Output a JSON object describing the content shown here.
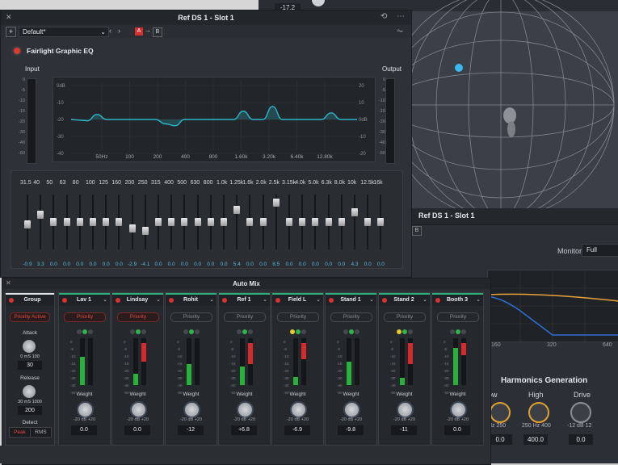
{
  "background": {
    "top_readout": "-17.2"
  },
  "ref_panel": {
    "title": "Ref DS 1 - Slot 1",
    "b_button": "B",
    "monitor_label": "Monitor",
    "monitor_value": "Full",
    "graph_ticks": [
      "160",
      "320",
      "640"
    ],
    "harmonics_title": "Harmonics Generation",
    "knobs": [
      {
        "label": "ow",
        "scale": "Hz  250",
        "value": "0.0"
      },
      {
        "label": "High",
        "scale": "250  Hz  400",
        "value": "400.0"
      },
      {
        "label": "Drive",
        "scale": "-12  dB  12",
        "value": "0.0"
      }
    ],
    "colors": {
      "orange": "#e8a23a",
      "blue": "#2f6fd4"
    }
  },
  "eq": {
    "window_title": "Ref DS 1 - Slot 1",
    "close": "✕",
    "preset": "Default*",
    "ab_a": "A",
    "ab_arrow": "→",
    "ab_b": "B",
    "plugin_name": "Fairlight Graphic EQ",
    "input_label": "Input",
    "output_label": "Output",
    "meter_scale": [
      "0",
      "-5",
      "-10",
      "-15",
      "-20",
      "-30",
      "-40",
      "-50"
    ],
    "gain_labels_left": [
      "0dB",
      "-10",
      "-20",
      "-30",
      "-40"
    ],
    "gain_labels_right": [
      "20",
      "10",
      "0dB",
      "-10",
      "-20"
    ],
    "freq_labels": [
      "50Hz",
      "100",
      "200",
      "400",
      "800",
      "1.60k",
      "3.20k",
      "6.40k",
      "12.80k"
    ],
    "curve_color": "#2bb7c9",
    "bands": [
      {
        "freq": "31.5",
        "gain": "-0.9"
      },
      {
        "freq": "40",
        "gain": "3.3"
      },
      {
        "freq": "50",
        "gain": "0.0"
      },
      {
        "freq": "63",
        "gain": "0.0"
      },
      {
        "freq": "80",
        "gain": "0.0"
      },
      {
        "freq": "100",
        "gain": "0.0"
      },
      {
        "freq": "125",
        "gain": "0.0"
      },
      {
        "freq": "160",
        "gain": "0.0"
      },
      {
        "freq": "200",
        "gain": "-2.9"
      },
      {
        "freq": "250",
        "gain": "-4.1"
      },
      {
        "freq": "315",
        "gain": "0.0"
      },
      {
        "freq": "400",
        "gain": "0.0"
      },
      {
        "freq": "500",
        "gain": "0.0"
      },
      {
        "freq": "630",
        "gain": "0.0"
      },
      {
        "freq": "800",
        "gain": "0.0"
      },
      {
        "freq": "1.0k",
        "gain": "0.0"
      },
      {
        "freq": "1.25k",
        "gain": "5.4"
      },
      {
        "freq": "1.6k",
        "gain": "0.0"
      },
      {
        "freq": "2.0k",
        "gain": "0.0"
      },
      {
        "freq": "2.5k",
        "gain": "8.5"
      },
      {
        "freq": "3.15k",
        "gain": "0.0"
      },
      {
        "freq": "4.0k",
        "gain": "0.0"
      },
      {
        "freq": "5.0k",
        "gain": "0.0"
      },
      {
        "freq": "6.3k",
        "gain": "0.0"
      },
      {
        "freq": "8.0k",
        "gain": "0.0"
      },
      {
        "freq": "10k",
        "gain": "4.3"
      },
      {
        "freq": "12.5k",
        "gain": "0.0"
      },
      {
        "freq": "16k",
        "gain": "0.0"
      }
    ]
  },
  "automix": {
    "title": "Auto Mix",
    "close": "✕",
    "group": {
      "name": "Group",
      "priority": "Priority Active",
      "attack_label": "Attack",
      "attack_scale": "0   mS   100",
      "attack_value": "30",
      "release_label": "Release",
      "release_scale": "30   mS   1000",
      "release_value": "200",
      "detect_label": "Detect",
      "peak": "Peak",
      "rms": "RMS"
    },
    "weight_label": "Weight",
    "db_scale": "-20  dB  +20",
    "meter_scale": [
      "0",
      "-5",
      "-10",
      "-15",
      "-20",
      "-30",
      "-40",
      "-50"
    ],
    "channels": [
      {
        "name": "Lav 1",
        "priority": "Priority",
        "priority_on": true,
        "weight": "0.0",
        "level": 0.6,
        "peak_red": 0.0,
        "yellow": false
      },
      {
        "name": "Lindsay",
        "priority": "Priority",
        "priority_on": true,
        "weight": "0.0",
        "level": 0.25,
        "peak_red": 0.4,
        "yellow": false
      },
      {
        "name": "Rohit",
        "priority": "Priority",
        "priority_on": false,
        "weight": "-12",
        "level": 0.45,
        "peak_red": 0.0,
        "yellow": false
      },
      {
        "name": "Ref 1",
        "priority": "Priority",
        "priority_on": false,
        "weight": "+6.8",
        "level": 0.4,
        "peak_red": 0.45,
        "yellow": false
      },
      {
        "name": "Field L",
        "priority": "Priority",
        "priority_on": false,
        "weight": "-6.9",
        "level": 0.18,
        "peak_red": 0.35,
        "yellow": true
      },
      {
        "name": "Stand 1",
        "priority": "Priority",
        "priority_on": false,
        "weight": "-9.8",
        "level": 0.5,
        "peak_red": 0.0,
        "yellow": false
      },
      {
        "name": "Stand 2",
        "priority": "Priority",
        "priority_on": false,
        "weight": "-11",
        "level": 0.15,
        "peak_red": 0.45,
        "yellow": true
      },
      {
        "name": "Booth 3",
        "priority": "Priority",
        "priority_on": false,
        "weight": "0.0",
        "level": 0.8,
        "peak_red": 0.25,
        "yellow": false
      }
    ]
  }
}
